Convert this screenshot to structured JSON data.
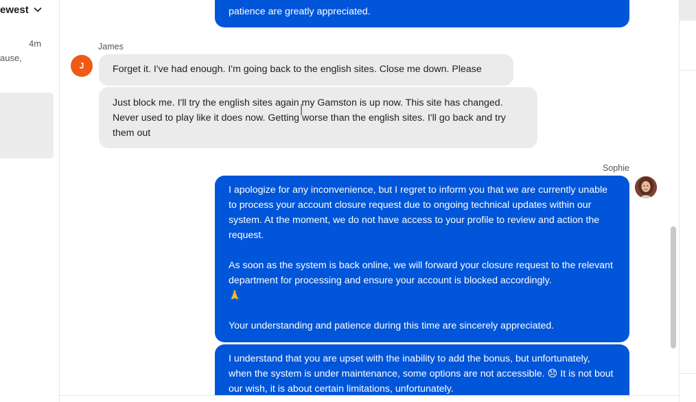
{
  "sidebar": {
    "sort_label": "ewest",
    "conversation": {
      "time": "4m",
      "preview": "ause,"
    }
  },
  "messages": {
    "top_agent_tail": "patience are greatly appreciated.",
    "james_name": "James",
    "james_initial": "J",
    "james_msg1": "Forget it. I've had enough. I'm going back to the english sites. Close me down. Please",
    "james_msg2": "Just block me. I'll try the english sites again my Gamston is up now. This site has changed. Never used to play like it does now. Getting worse than the english sites. I'll go back and try them out",
    "sophie_name": "Sophie",
    "sophie_msg1_p1": "I apologize for any inconvenience, but I regret to inform you that we are currently unable to process your account closure request due to ongoing technical updates within our system. At the moment, we do not have access to your profile to review and action the request.",
    "sophie_msg1_p2": "As soon as the system is back online, we will forward your closure request to the relevant department for processing and ensure your account is blocked accordingly.",
    "sophie_msg1_p2_emoji": "🙏",
    "sophie_msg1_p3": "Your understanding and patience during this time are sincerely appreciated.",
    "sophie_msg2_a": "I understand that you are upset with the inability to add the bonus, but unfortunately, when the system is under maintenance, some options are not accessible.",
    "sophie_msg2_emoji": "😞",
    "sophie_msg2_b": "It is not bout our wish, it is about certain limitations, unfortunately."
  },
  "colors": {
    "agent_bubble": "#0055d9",
    "customer_bubble": "#ebebeb",
    "customer_avatar": "#f15a16"
  }
}
